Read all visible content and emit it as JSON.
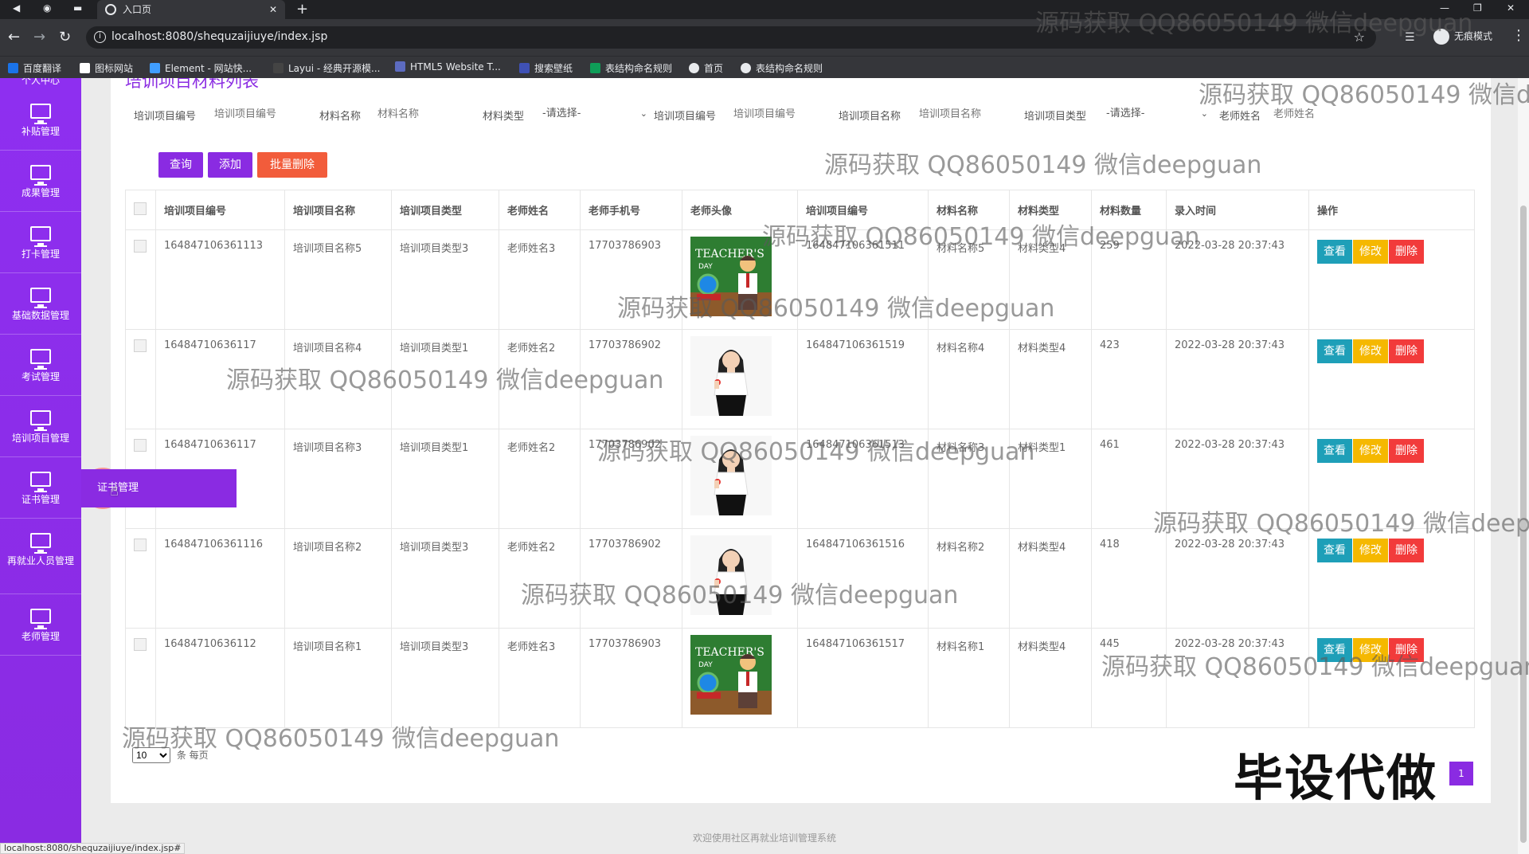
{
  "browser": {
    "tab_title": "入口页",
    "url": "localhost:8080/shequzaijiuye/index.jsp",
    "incognito_label": "无痕模式",
    "bookmarks": [
      "百度翻译",
      "图标网站",
      "Element - 网站快...",
      "Layui - 经典开源模...",
      "HTML5 Website T...",
      "搜索壁纸",
      "表结构命名规则",
      "首页",
      "表结构命名规则"
    ],
    "status_url": "localhost:8080/shequzaijiuye/index.jsp#"
  },
  "sidebar": {
    "top_partial": "个人中心",
    "items": [
      "补贴管理",
      "成果管理",
      "打卡管理",
      "基础数据管理",
      "考试管理",
      "培训项目管理",
      "证书管理",
      "再就业人员管理",
      "老师管理"
    ],
    "popup_label": "证书管理"
  },
  "page": {
    "title": "培训项目材料列表",
    "filters": {
      "f1_label": "培训项目编号",
      "f1_placeholder": "培训项目编号",
      "f2_label": "材料名称",
      "f2_placeholder": "材料名称",
      "f3_label": "材料类型",
      "f3_value": "-请选择-",
      "f4_label": "培训项目编号",
      "f4_placeholder": "培训项目编号",
      "f5_label": "培训项目名称",
      "f5_placeholder": "培训项目名称",
      "f6_label": "培训项目类型",
      "f6_value": "-请选择-",
      "f7_label": "老师姓名",
      "f7_placeholder": "老师姓名"
    },
    "buttons": {
      "query": "查询",
      "add": "添加",
      "batch_delete": "批量删除"
    },
    "columns": [
      "培训项目编号",
      "培训项目名称",
      "培训项目类型",
      "老师姓名",
      "老师手机号",
      "老师头像",
      "培训项目编号",
      "材料名称",
      "材料类型",
      "材料数量",
      "录入时间",
      "操作"
    ],
    "row_actions": {
      "view": "查看",
      "edit": "修改",
      "delete": "删除"
    },
    "rows": [
      {
        "project_no": "164847106361113",
        "project_name": "培训项目名称5",
        "project_type": "培训项目类型3",
        "teacher": "老师姓名3",
        "phone": "17703786903",
        "avatar": "teachers-day",
        "material_project_no": "164847106361511",
        "material_name": "材料名称5",
        "material_type": "材料类型4",
        "qty": "259",
        "time": "2022-03-28 20:37:43"
      },
      {
        "project_no": "16484710636117",
        "project_name": "培训项目名称4",
        "project_type": "培训项目类型1",
        "teacher": "老师姓名2",
        "phone": "17703786902",
        "avatar": "teacher-woman",
        "material_project_no": "164847106361519",
        "material_name": "材料名称4",
        "material_type": "材料类型4",
        "qty": "423",
        "time": "2022-03-28 20:37:43"
      },
      {
        "project_no": "16484710636117",
        "project_name": "培训项目名称3",
        "project_type": "培训项目类型1",
        "teacher": "老师姓名2",
        "phone": "17703786902",
        "avatar": "teacher-woman",
        "material_project_no": "164847106361513",
        "material_name": "材料名称3",
        "material_type": "材料类型1",
        "qty": "461",
        "time": "2022-03-28 20:37:43"
      },
      {
        "project_no": "164847106361116",
        "project_name": "培训项目名称2",
        "project_type": "培训项目类型3",
        "teacher": "老师姓名2",
        "phone": "17703786902",
        "avatar": "teacher-woman",
        "material_project_no": "164847106361516",
        "material_name": "材料名称2",
        "material_type": "材料类型4",
        "qty": "418",
        "time": "2022-03-28 20:37:43"
      },
      {
        "project_no": "16484710636112",
        "project_name": "培训项目名称1",
        "project_type": "培训项目类型3",
        "teacher": "老师姓名3",
        "phone": "17703786903",
        "avatar": "teachers-day",
        "material_project_no": "164847106361517",
        "material_name": "材料名称1",
        "material_type": "材料类型4",
        "qty": "445",
        "time": "2022-03-28 20:37:43"
      }
    ],
    "pager": {
      "page_size": "10",
      "page_size_suffix": "条 每页",
      "current_page": "1"
    },
    "footer": "欢迎使用社区再就业培训管理系统"
  },
  "overlay": {
    "watermark": "源码获取 QQ86050149 微信deepguan",
    "watermark_cut_right": "源码获取 QQ86050149 微信de",
    "watermark_cut_top": "源码获取 QQ86050149 微信deepguan",
    "watermark_cut_right2": "源码获取 QQ86050149 微信deepg",
    "brand": "毕设代做"
  },
  "colors": {
    "accent": "#8a2be2",
    "view": "#1e9fb8",
    "edit": "#f5b800",
    "delete": "#f23b3b"
  }
}
